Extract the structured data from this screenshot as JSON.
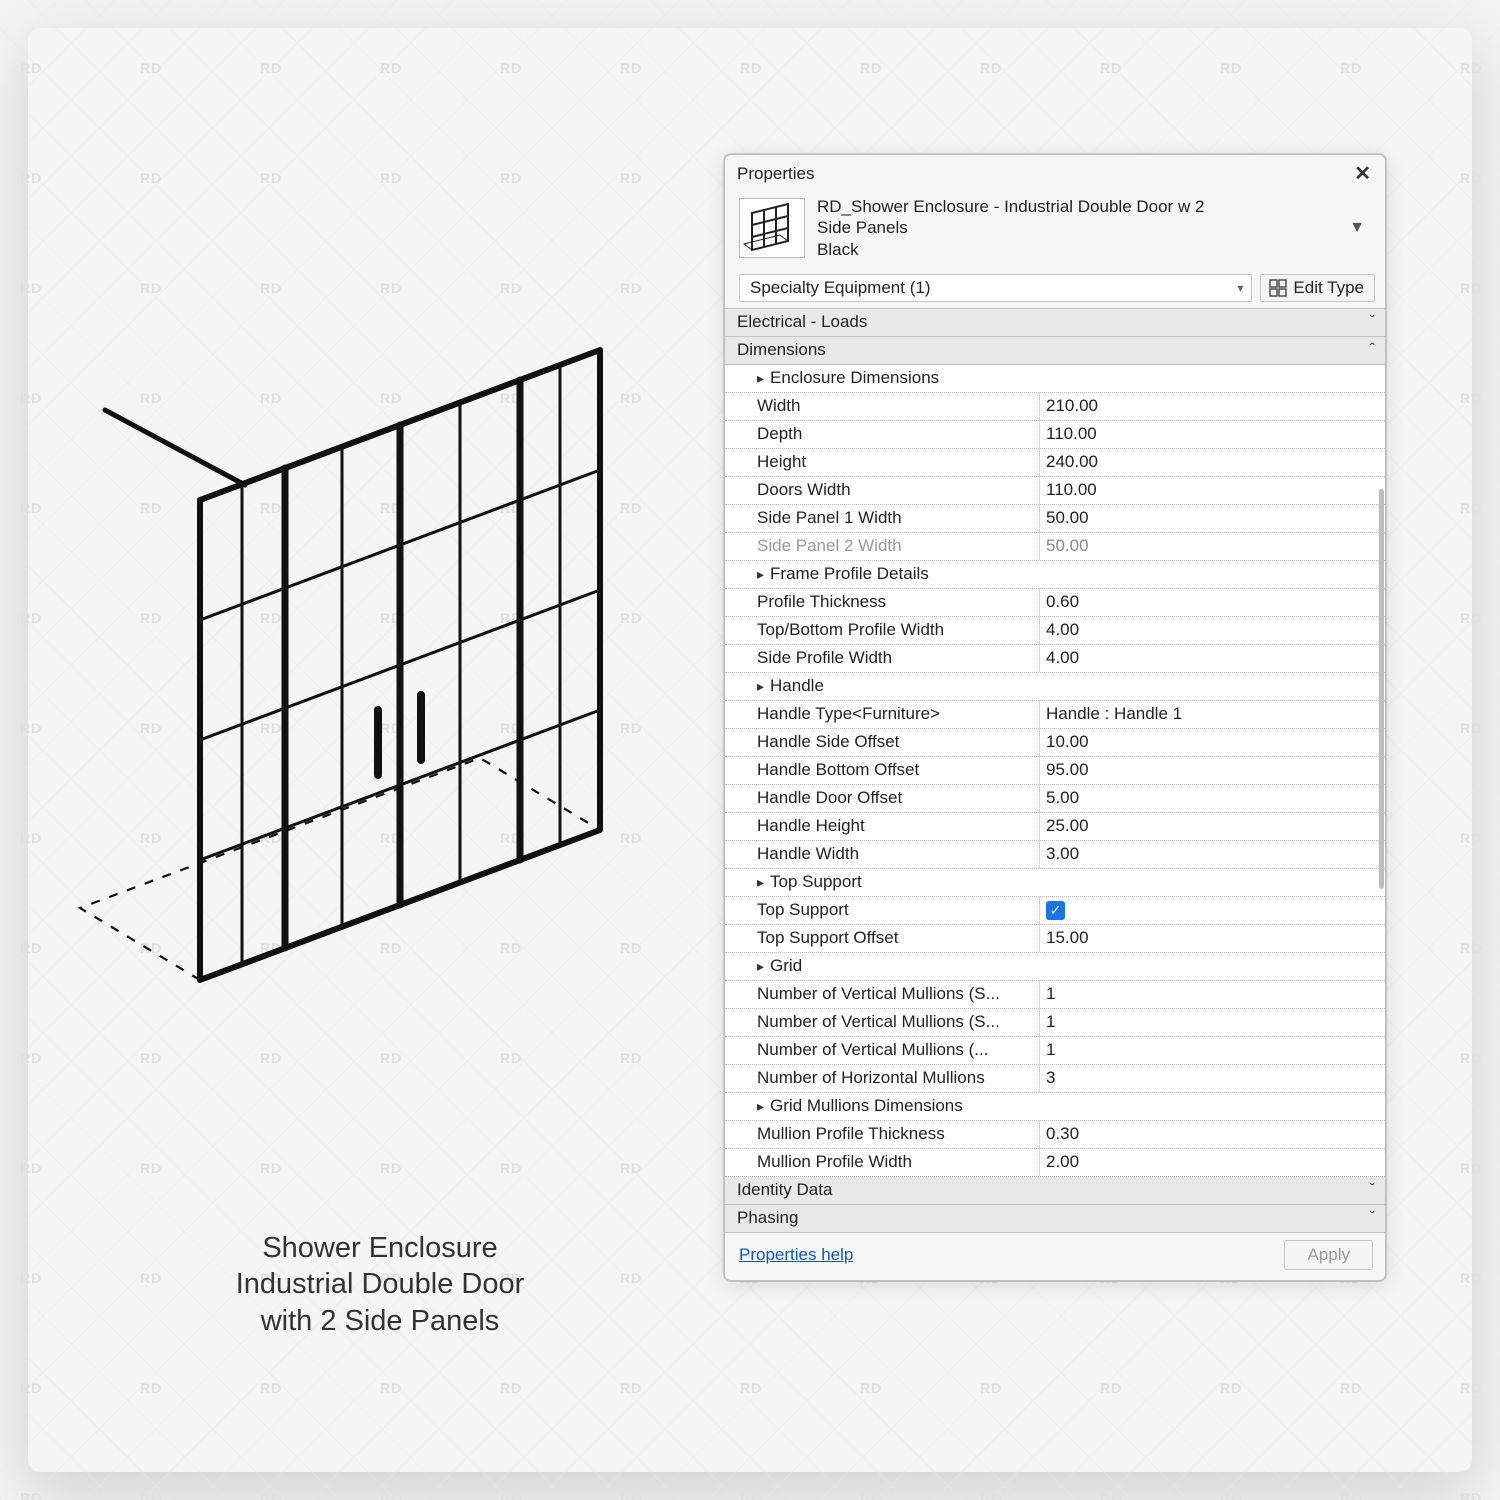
{
  "caption_line1": "Shower Enclosure",
  "caption_line2": "Industrial Double Door",
  "caption_line3": "with 2 Side Panels",
  "panel": {
    "title": "Properties",
    "type_line1": "RD_Shower Enclosure - Industrial Double Door w 2",
    "type_line2": "Side Panels",
    "type_line3": "Black",
    "filter": "Specialty Equipment (1)",
    "edit_type": "Edit Type",
    "footer_link": "Properties help",
    "apply": "Apply"
  },
  "rows": [
    {
      "kind": "header",
      "label": "Electrical - Loads",
      "expand": "down"
    },
    {
      "kind": "header",
      "label": "Dimensions",
      "expand": "up"
    },
    {
      "kind": "group",
      "label": "Enclosure Dimensions"
    },
    {
      "kind": "param",
      "label": "Width",
      "value": "210.00"
    },
    {
      "kind": "param",
      "label": "Depth",
      "value": "110.00"
    },
    {
      "kind": "param",
      "label": "Height",
      "value": "240.00"
    },
    {
      "kind": "param",
      "label": "Doors Width",
      "value": "110.00"
    },
    {
      "kind": "param",
      "label": "Side Panel 1 Width",
      "value": "50.00"
    },
    {
      "kind": "param",
      "label": "Side Panel 2 Width",
      "value": "50.00",
      "dim": true
    },
    {
      "kind": "group",
      "label": "Frame Profile Details"
    },
    {
      "kind": "param",
      "label": "Profile Thickness",
      "value": "0.60"
    },
    {
      "kind": "param",
      "label": "Top/Bottom Profile Width",
      "value": "4.00"
    },
    {
      "kind": "param",
      "label": "Side Profile Width",
      "value": "4.00"
    },
    {
      "kind": "group",
      "label": "Handle"
    },
    {
      "kind": "param",
      "label": "Handle Type<Furniture>",
      "value": "Handle : Handle 1"
    },
    {
      "kind": "param",
      "label": "Handle Side Offset",
      "value": "10.00"
    },
    {
      "kind": "param",
      "label": "Handle Bottom Offset",
      "value": "95.00"
    },
    {
      "kind": "param",
      "label": "Handle Door Offset",
      "value": "5.00"
    },
    {
      "kind": "param",
      "label": "Handle Height",
      "value": "25.00"
    },
    {
      "kind": "param",
      "label": "Handle Width",
      "value": "3.00"
    },
    {
      "kind": "group",
      "label": "Top Support"
    },
    {
      "kind": "check",
      "label": "Top Support",
      "checked": true
    },
    {
      "kind": "param",
      "label": "Top Support Offset",
      "value": "15.00"
    },
    {
      "kind": "group",
      "label": "Grid"
    },
    {
      "kind": "param",
      "label": "Number of Vertical Mullions (S...",
      "value": "1"
    },
    {
      "kind": "param",
      "label": "Number of Vertical Mullions (S...",
      "value": "1"
    },
    {
      "kind": "param",
      "label": "Number of Vertical Mullions (...",
      "value": "1"
    },
    {
      "kind": "param",
      "label": "Number of Horizontal Mullions",
      "value": "3"
    },
    {
      "kind": "group",
      "label": "Grid Mullions Dimensions"
    },
    {
      "kind": "param",
      "label": "Mullion Profile Thickness",
      "value": "0.30"
    },
    {
      "kind": "param",
      "label": "Mullion Profile Width",
      "value": "2.00"
    },
    {
      "kind": "header",
      "label": "Identity Data",
      "expand": "down"
    },
    {
      "kind": "header",
      "label": "Phasing",
      "expand": "down"
    }
  ]
}
